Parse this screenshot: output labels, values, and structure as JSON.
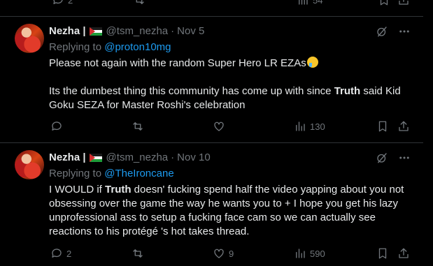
{
  "prev_actions": {
    "views_count": "54"
  },
  "tweets": [
    {
      "display_name": "Nezha |",
      "handle": "@tsm_nezha",
      "date": "Nov 5",
      "replying_prefix": "Replying to",
      "replying_to": "@proton10mg",
      "body_line1": "Please not again with the random Super Hero LR EZAs",
      "body_p2_a": "Its the dumbest thing this community has come up with since ",
      "body_p2_bold": "Truth",
      "body_p2_b": " said Kid Goku SEZA for Master Roshi's celebration",
      "replies": "",
      "retweets": "",
      "likes": "",
      "views": "130"
    },
    {
      "display_name": "Nezha |",
      "handle": "@tsm_nezha",
      "date": "Nov 10",
      "replying_prefix": "Replying to",
      "replying_to": "@TheIroncane",
      "body_a": "I WOULD if ",
      "body_bold": "Truth",
      "body_b": " doesn' fucking spend half the video yapping about you not obsessing over the game the way he wants you to + I hope you get his lazy unprofessional ass to setup a fucking face cam so we can actually see reactions to his protégé 's hot takes thread.",
      "replies": "2",
      "retweets": "",
      "likes": "9",
      "views": "590"
    }
  ],
  "dot_separator": "·",
  "icons": [
    "reply-icon",
    "retweet-icon",
    "like-icon",
    "views-icon",
    "bookmark-icon",
    "share-icon",
    "grok-icon",
    "more-icon",
    "palestine-flag-icon",
    "crying-face-emoji"
  ]
}
